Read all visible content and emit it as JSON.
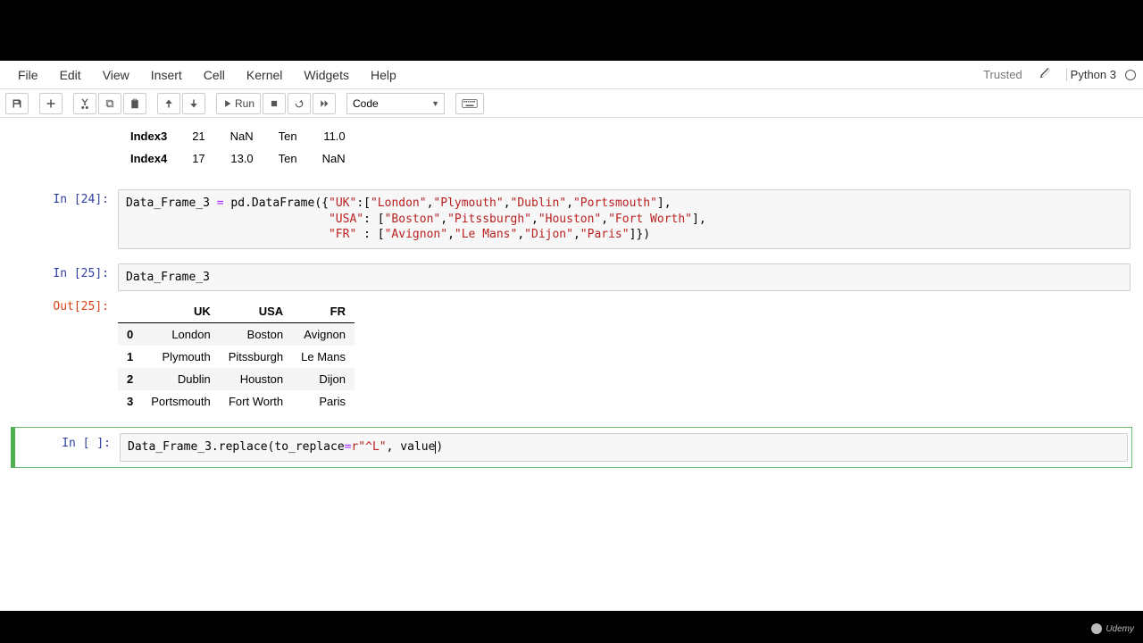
{
  "menu": {
    "file": "File",
    "edit": "Edit",
    "view": "View",
    "insert": "Insert",
    "cell": "Cell",
    "kernel": "Kernel",
    "widgets": "Widgets",
    "help": "Help"
  },
  "header": {
    "trusted": "Trusted",
    "kernel": "Python 3"
  },
  "toolbar": {
    "run": "Run",
    "cell_type": "Code"
  },
  "partial_table": {
    "rows": [
      {
        "idx": "Index3",
        "c0": "21",
        "c1": "NaN",
        "c2": "Ten",
        "c3": "11.0"
      },
      {
        "idx": "Index4",
        "c0": "17",
        "c1": "13.0",
        "c2": "Ten",
        "c3": "NaN"
      }
    ]
  },
  "cell24": {
    "prompt": "In [24]:",
    "code_plain": "Data_Frame_3 = pd.DataFrame({\"UK\":[\"London\",\"Plymouth\",\"Dublin\",\"Portsmouth\"],\n                             \"USA\": [\"Boston\",\"Pitssburgh\",\"Houston\",\"Fort Worth\"],\n                             \"FR\" : [\"Avignon\",\"Le Mans\",\"Dijon\",\"Paris\"]})"
  },
  "cell25": {
    "prompt_in": "In [25]:",
    "prompt_out": "Out[25]:",
    "code": "Data_Frame_3",
    "columns": [
      "",
      "UK",
      "USA",
      "FR"
    ],
    "rows": [
      {
        "idx": "0",
        "uk": "London",
        "usa": "Boston",
        "fr": "Avignon"
      },
      {
        "idx": "1",
        "uk": "Plymouth",
        "usa": "Pitssburgh",
        "fr": "Le Mans"
      },
      {
        "idx": "2",
        "uk": "Dublin",
        "usa": "Houston",
        "fr": "Dijon"
      },
      {
        "idx": "3",
        "uk": "Portsmouth",
        "usa": "Fort Worth",
        "fr": "Paris"
      }
    ]
  },
  "cell_active": {
    "prompt": "In [ ]:",
    "code_plain": "Data_Frame_3.replace(to_replace=r\"^L\", value)"
  },
  "watermark": "Udemy"
}
